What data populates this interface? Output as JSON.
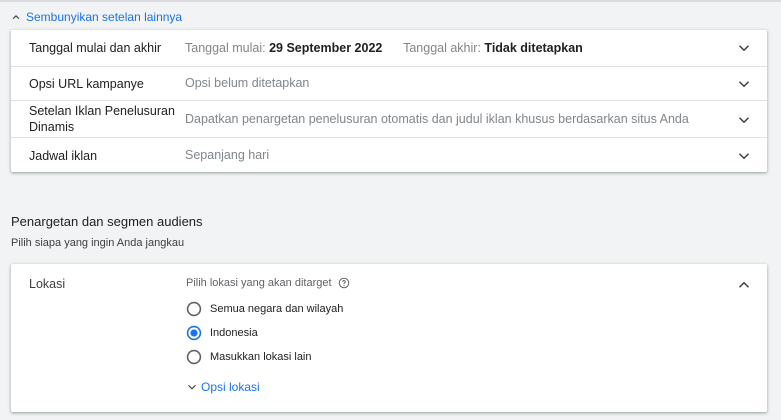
{
  "toggle_more_settings": "Sembunyikan setelan lainnya",
  "settings_rows": [
    {
      "label": "Tanggal mulai dan akhir",
      "start_key": "Tanggal mulai:",
      "start_value": "29 September 2022",
      "end_key": "Tanggal akhir:",
      "end_value": "Tidak ditetapkan"
    },
    {
      "label": "Opsi URL kampanye",
      "value": "Opsi belum ditetapkan"
    },
    {
      "label": "Setelan Iklan Penelusuran Dinamis",
      "value": "Dapatkan penargetan penelusuran otomatis dan judul iklan khusus berdasarkan situs Anda"
    },
    {
      "label": "Jadwal iklan",
      "value": "Sepanjang hari"
    }
  ],
  "audience_section": {
    "title": "Penargetan dan segmen audiens",
    "subtitle": "Pilih siapa yang ingin Anda jangkau"
  },
  "location": {
    "label": "Lokasi",
    "prompt": "Pilih lokasi yang akan ditarget",
    "options": [
      {
        "label": "Semua negara dan wilayah",
        "selected": false
      },
      {
        "label": "Indonesia",
        "selected": true
      },
      {
        "label": "Masukkan lokasi lain",
        "selected": false
      }
    ],
    "more_options": "Opsi lokasi"
  },
  "colors": {
    "accent": "#1a73e8",
    "text": "#202124",
    "muted": "#80868b",
    "background": "#f1f3f4"
  }
}
